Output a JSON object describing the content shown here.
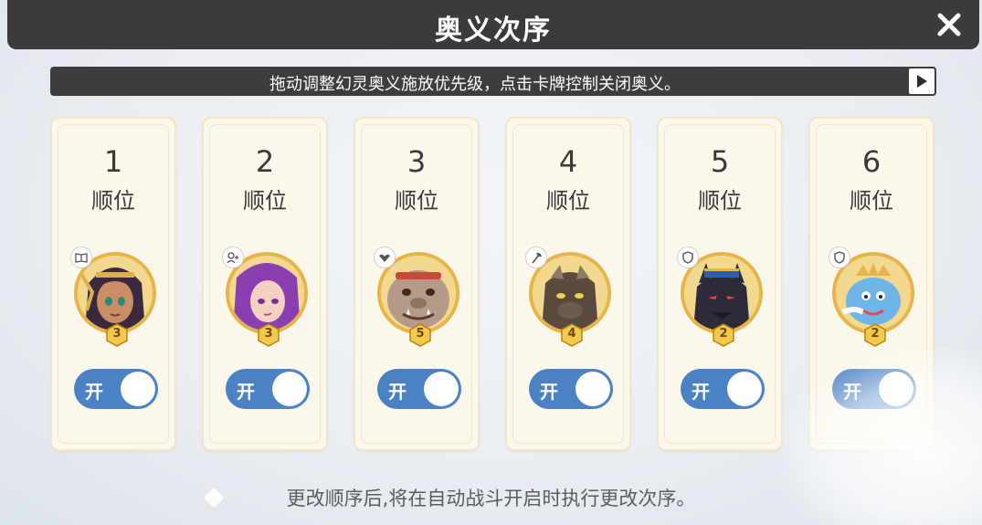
{
  "header": {
    "title": "奥义次序",
    "close_icon": "close-icon"
  },
  "tip": {
    "text": "拖动调整幻灵奥义施放优先级，点击卡牌控制关闭奥义。",
    "play_icon": "play-icon"
  },
  "cards": [
    {
      "rank": "1",
      "rank_label": "顺位",
      "level": "3",
      "type_icon": "book-icon",
      "portrait": "dark-haired-girl",
      "toggle": "开",
      "on": true
    },
    {
      "rank": "2",
      "rank_label": "顺位",
      "level": "3",
      "type_icon": "support-icon",
      "portrait": "purple-haired-girl",
      "toggle": "开",
      "on": true
    },
    {
      "rank": "3",
      "rank_label": "顺位",
      "level": "5",
      "type_icon": "wing-icon",
      "portrait": "ogre-beast",
      "toggle": "开",
      "on": true
    },
    {
      "rank": "4",
      "rank_label": "顺位",
      "level": "4",
      "type_icon": "axe-icon",
      "portrait": "horned-beast",
      "toggle": "开",
      "on": true
    },
    {
      "rank": "5",
      "rank_label": "顺位",
      "level": "2",
      "type_icon": "shield-icon",
      "portrait": "dark-dragon",
      "toggle": "开",
      "on": true
    },
    {
      "rank": "6",
      "rank_label": "顺位",
      "level": "2",
      "type_icon": "shield-icon",
      "portrait": "blue-dragon",
      "toggle": "开",
      "on": true
    }
  ],
  "footer": {
    "text": "更改顺序后,将在自动战斗开启时执行更改次序。"
  },
  "colors": {
    "accent": "#4b82c4",
    "gold": "#e7b44a",
    "dark": "#3b3b3d"
  }
}
